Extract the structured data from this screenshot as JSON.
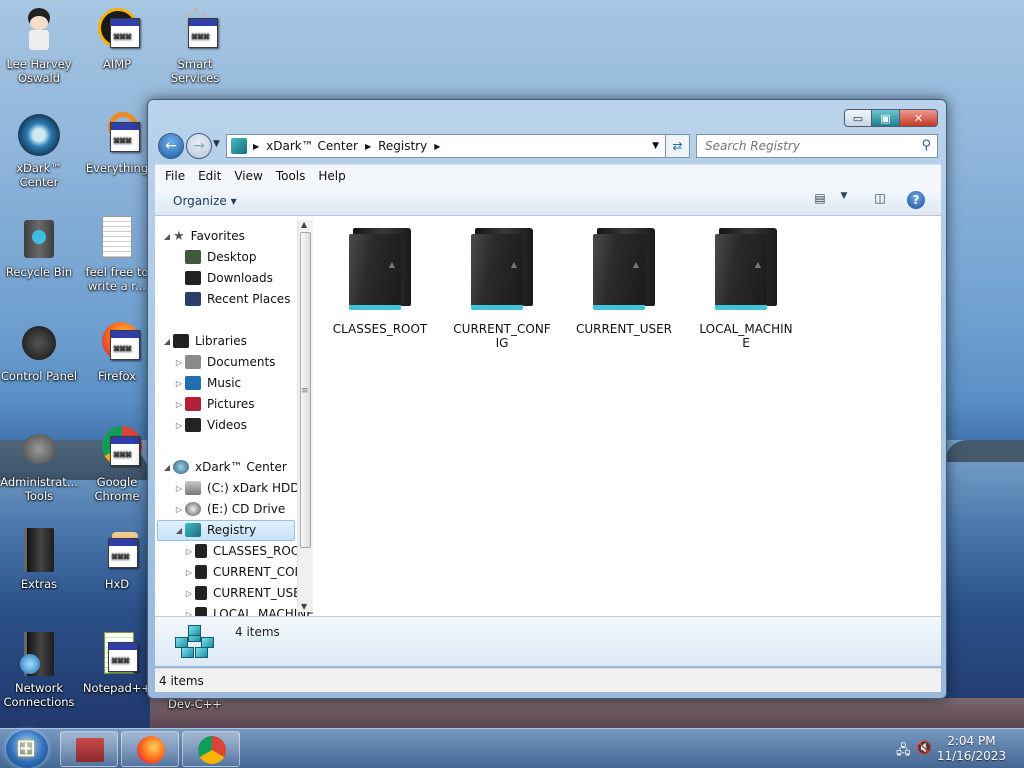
{
  "desktop": {
    "icons": [
      {
        "label": "Lee Harvey Oswald"
      },
      {
        "label": "AIMP"
      },
      {
        "label": "Smart Services"
      },
      {
        "label": "xDark™ Center"
      },
      {
        "label": "Everything"
      },
      {
        "label": "Recycle Bin"
      },
      {
        "label": "feel free to write a r..."
      },
      {
        "label": "Control Panel"
      },
      {
        "label": "Firefox"
      },
      {
        "label": "Administrat... Tools"
      },
      {
        "label": "Google Chrome"
      },
      {
        "label": "Extras"
      },
      {
        "label": "HxD"
      },
      {
        "label": "Network Connections"
      },
      {
        "label": "Notepad++"
      },
      {
        "label": "Dev-C++"
      }
    ]
  },
  "window": {
    "address": {
      "crumbs": [
        "xDark™ Center",
        "Registry"
      ]
    },
    "search": {
      "placeholder": "Search Registry"
    },
    "menu": [
      "File",
      "Edit",
      "View",
      "Tools",
      "Help"
    ],
    "toolbar": {
      "organize": "Organize ▾"
    },
    "nav": {
      "favorites": "Favorites",
      "desktop": "Desktop",
      "downloads": "Downloads",
      "recent": "Recent Places",
      "libraries": "Libraries",
      "documents": "Documents",
      "music": "Music",
      "pictures": "Pictures",
      "videos": "Videos",
      "computer": "xDark™ Center",
      "cdrive": "(C:) xDark HDD",
      "edrive": "(E:) CD Drive",
      "registry": "Registry",
      "hive1": "CLASSES_ROOT",
      "hive2": "CURRENT_CONFIG",
      "hive3": "CURRENT_USER",
      "hive4": "LOCAL_MACHINE"
    },
    "folders": [
      {
        "name": "CLASSES_ROOT"
      },
      {
        "name": "CURRENT_CONFIG"
      },
      {
        "name": "CURRENT_USER"
      },
      {
        "name": "LOCAL_MACHINE"
      }
    ],
    "details": {
      "count": "4 items"
    },
    "status": {
      "text": "4 items"
    }
  },
  "taskbar": {
    "clock": {
      "time": "2:04 PM",
      "date": "11/16/2023"
    }
  },
  "colors": {
    "accent": "#3fc4d8",
    "selection": "#c6e2f8"
  }
}
